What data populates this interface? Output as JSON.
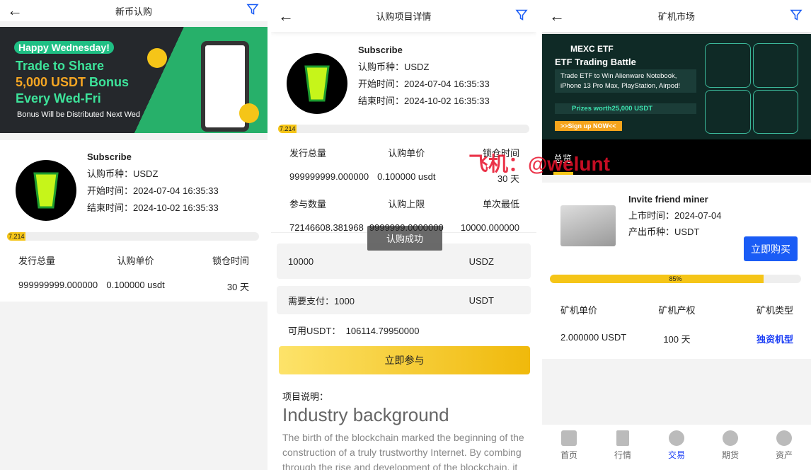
{
  "panel1": {
    "title": "新币认购",
    "banner": {
      "tag": "Happy Wednesday!",
      "line1": "Trade to Share",
      "line2a": "5,000 USDT",
      "line2b": " Bonus",
      "line3": "Every Wed-Fri",
      "note": "Bonus Will be Distributed Next Wed"
    },
    "project": {
      "name": "Subscribe",
      "coin": "认购币种：USDZ",
      "start": "开始时间：2024-07-04 16:35:33",
      "end": "结束时间：2024-10-02 16:35:33",
      "progress_label": "7.214",
      "progress": 7.214
    },
    "stats": [
      "发行总量",
      "认购单价",
      "锁仓时间",
      "999999999.000000",
      "0.100000 usdt",
      "30 天"
    ]
  },
  "panel2": {
    "title": "认购项目详情",
    "project": {
      "name": "Subscribe",
      "coin": "认购币种：USDZ",
      "start": "开始时间：2024-07-04 16:35:33",
      "end": "结束时间：2024-10-02 16:35:33",
      "progress_label": "7.214",
      "progress": 7.214
    },
    "stats": [
      "发行总量",
      "认购单价",
      "锁仓时间",
      "999999999.000000",
      "0.100000 usdt",
      "30 天",
      "参与数量",
      "认购上限",
      "单次最低",
      "72146608.381968",
      "9999999.0000000",
      "10000.000000"
    ],
    "amount_value": "10000",
    "amount_unit": "USDZ",
    "pay_label": "需要支付：",
    "pay_value": "1000",
    "pay_unit": "USDT",
    "available": "可用USDT：  106114.79950000",
    "submit": "立即参与",
    "toast": "认购成功",
    "desc_label": "项目说明：",
    "desc_title": "Industry background",
    "desc_text": "The birth of the blockchain marked the beginning of the construction of a truly trustworthy Internet. By combing through the rise and development of the blockchain, it"
  },
  "panel3": {
    "title": "矿机市场",
    "banner": {
      "brand": "MEXC ETF",
      "title": "ETF Trading Battle",
      "text": "Trade ETF to Win Alienware Notebook, iPhone 13 Pro Max, PlayStation, Airpod!",
      "prize": "Prizes worth25,000 USDT",
      "cta": ">>Sign up NOW<<"
    },
    "tab": "总览",
    "miner": {
      "name": "Invite friend miner",
      "listed": "上市时间：2024-07-04",
      "coin": "产出币种：USDT",
      "buy": "立即购买",
      "progress_label": "85%",
      "progress": 85
    },
    "stats": [
      "矿机单价",
      "矿机产权",
      "矿机类型",
      "2.000000 USDT",
      "100 天",
      "独资机型"
    ],
    "nav": [
      "首页",
      "行情",
      "交易",
      "期货",
      "资产"
    ],
    "nav_active": 2
  },
  "watermark": "飞机：@welunt",
  "colors": {
    "accent": "#f5c518",
    "blue": "#1a5cf5",
    "link": "#1a3df5",
    "watermark": "#e8102a"
  }
}
